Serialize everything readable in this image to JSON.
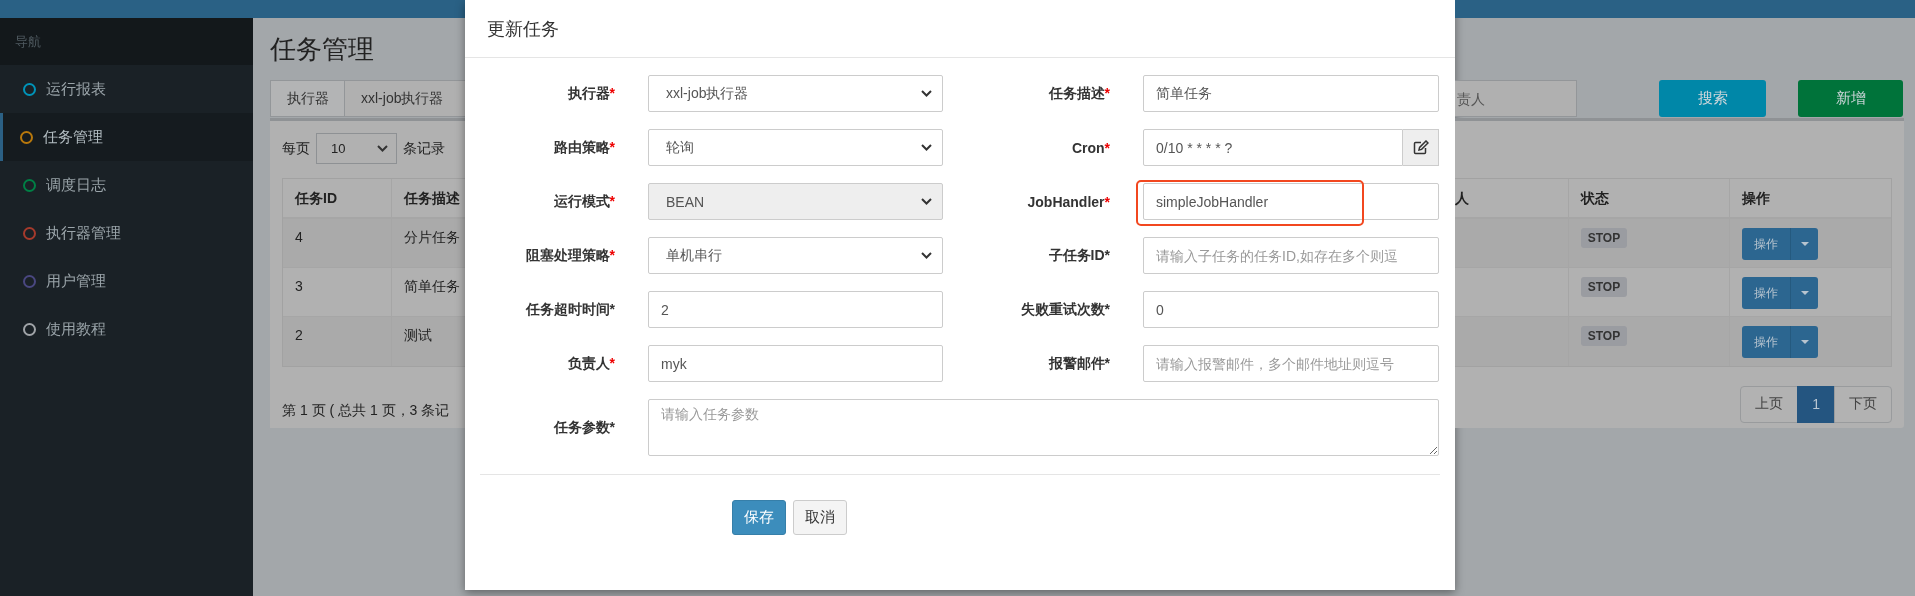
{
  "sidebar": {
    "heading": "导航",
    "items": [
      {
        "label": "运行报表",
        "color": "#0093b8",
        "selected": false
      },
      {
        "label": "任务管理",
        "color": "#b8780c",
        "selected": true
      },
      {
        "label": "调度日志",
        "color": "#007f45",
        "selected": false
      },
      {
        "label": "执行器管理",
        "color": "#a63a2c",
        "selected": false
      },
      {
        "label": "用户管理",
        "color": "#4a4780",
        "selected": false
      },
      {
        "label": "使用教程",
        "color": "#a0a4a8",
        "selected": false
      }
    ]
  },
  "page": {
    "title": "任务管理",
    "filter": {
      "executor_label": "执行器",
      "executor_value": "xxl-job执行器",
      "owner_placeholder": "责人",
      "buttons": [
        {
          "label": "搜索",
          "kind": "search"
        },
        {
          "label": "新增",
          "kind": "add"
        }
      ]
    },
    "page_size": {
      "prefix": "每页",
      "value": "10",
      "suffix": "条记录"
    },
    "table": {
      "columns": [
        "任务ID",
        "任务描述",
        "人",
        "状态",
        "操作"
      ],
      "rows": [
        {
          "id": "4",
          "description": "分片任务",
          "status": "STOP",
          "action": "操作"
        },
        {
          "id": "3",
          "description": "简单任务",
          "status": "STOP",
          "action": "操作"
        },
        {
          "id": "2",
          "description": "测试",
          "status": "STOP",
          "action": "操作"
        }
      ]
    },
    "summary": "第 1 页 ( 总共 1 页，3 条记",
    "pagination": [
      {
        "label": "上页",
        "selected": false
      },
      {
        "label": "1",
        "selected": true
      },
      {
        "label": "下页",
        "selected": false
      }
    ]
  },
  "dialog": {
    "title": "更新任务",
    "fields": [
      {
        "kind": "select",
        "label": "执行器",
        "star": "*",
        "required": true,
        "value": "xxl-job执行器",
        "disabled": false,
        "highlighted": false
      },
      {
        "kind": "input",
        "label": "任务描述",
        "star": "*",
        "required": true,
        "value": "简单任务",
        "disabled": false,
        "highlighted": false
      },
      {
        "kind": "select",
        "label": "路由策略",
        "star": "*",
        "required": true,
        "value": "轮询",
        "disabled": false,
        "highlighted": false
      },
      {
        "kind": "cron",
        "label": "Cron",
        "star": "*",
        "required": true,
        "value": "0/10 * * * * ?",
        "disabled": false,
        "highlighted": false
      },
      {
        "kind": "select",
        "label": "运行模式",
        "star": "*",
        "required": true,
        "value": "BEAN",
        "disabled": true,
        "highlighted": false
      },
      {
        "kind": "input",
        "label": "JobHandler",
        "star": "*",
        "required": true,
        "value": "simpleJobHandler",
        "disabled": false,
        "highlighted": true
      },
      {
        "kind": "select",
        "label": "阻塞处理策略",
        "star": "*",
        "required": true,
        "value": "单机串行",
        "disabled": false,
        "highlighted": false
      },
      {
        "kind": "input",
        "label": "子任务ID",
        "star": "*",
        "required": false,
        "placeholder": "请输入子任务的任务ID,如存在多个则逗",
        "disabled": false,
        "highlighted": false
      },
      {
        "kind": "input",
        "label": "任务超时时间",
        "star": "*",
        "required": false,
        "value": "2",
        "disabled": false,
        "highlighted": false
      },
      {
        "kind": "input",
        "label": "失败重试次数",
        "star": "*",
        "required": false,
        "value": "0",
        "disabled": false,
        "highlighted": false
      },
      {
        "kind": "input",
        "label": "负责人",
        "star": "*",
        "required": true,
        "value": "myk",
        "disabled": false,
        "highlighted": false
      },
      {
        "kind": "input",
        "label": "报警邮件",
        "star": "*",
        "required": false,
        "placeholder": "请输入报警邮件，多个邮件地址则逗号",
        "disabled": false,
        "highlighted": false
      },
      {
        "kind": "textarea",
        "label": "任务参数",
        "star": "*",
        "required": false,
        "placeholder": "请输入任务参数",
        "disabled": false,
        "highlighted": false
      }
    ],
    "buttons": [
      {
        "label": "保存",
        "kind": "primary"
      },
      {
        "label": "取消",
        "kind": "default"
      }
    ]
  }
}
